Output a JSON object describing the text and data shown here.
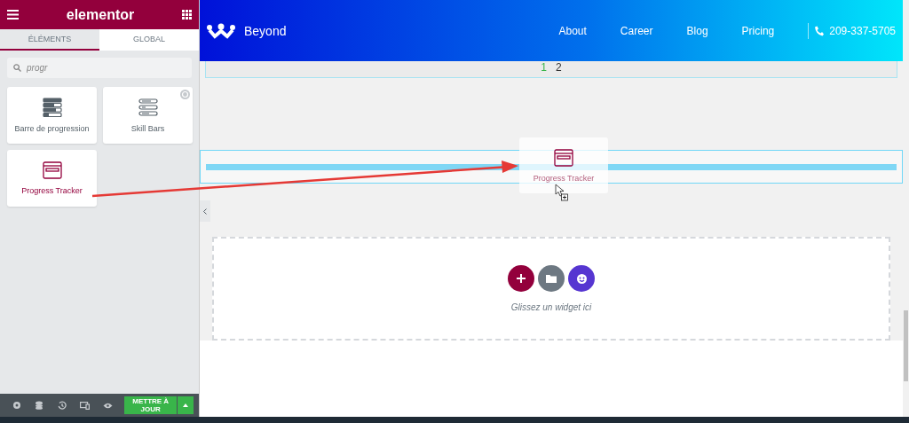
{
  "panel": {
    "title": "elementor",
    "tabs": [
      {
        "label": "ÉLÉMENTS",
        "selected": true
      },
      {
        "label": "GLOBAL",
        "selected": false
      }
    ],
    "search": {
      "value": "progr"
    },
    "widgets": [
      {
        "label": "Barre de progression",
        "kind": "progress",
        "pro": false,
        "selected": false
      },
      {
        "label": "Skill Bars",
        "kind": "skills",
        "pro": true,
        "selected": false
      },
      {
        "label": "Progress Tracker",
        "kind": "tracker",
        "pro": false,
        "selected": true
      }
    ],
    "update_button": "METTRE À JOUR"
  },
  "site": {
    "brand": "Beyond",
    "nav": [
      "About",
      "Career",
      "Blog",
      "Pricing"
    ],
    "phone": "209-337-5705",
    "pagination": [
      {
        "label": "1",
        "selected": true
      },
      {
        "label": "2",
        "selected": false
      }
    ],
    "drag_widget": "Progress Tracker",
    "dropzone_hint": "Glissez un widget ici"
  }
}
